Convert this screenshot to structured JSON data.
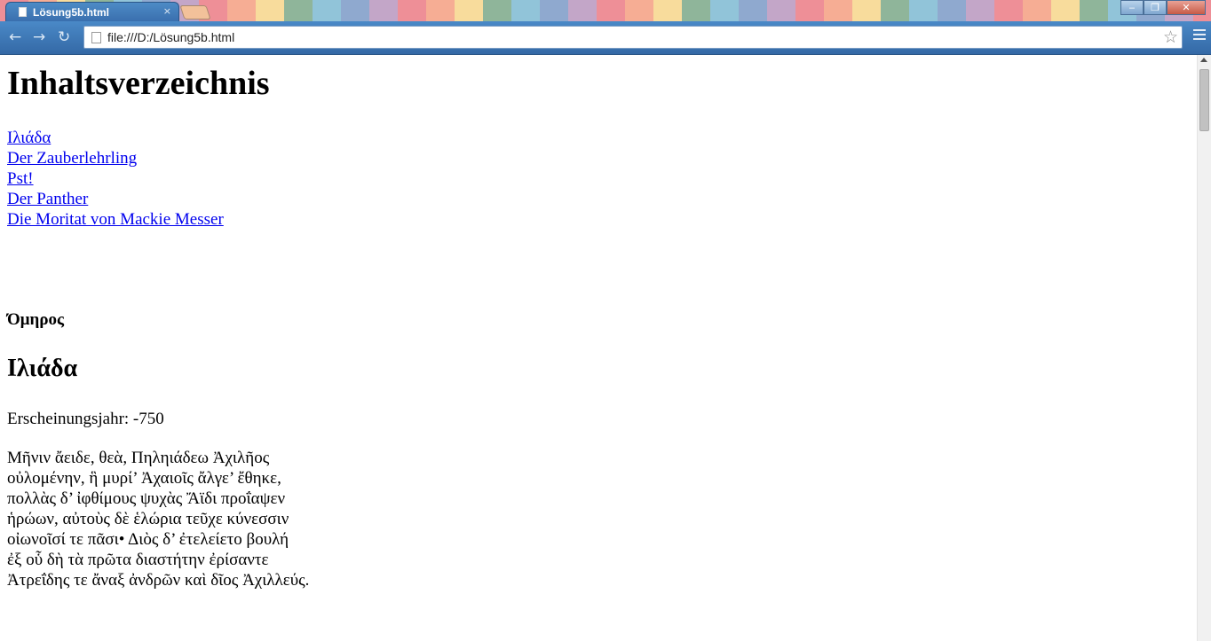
{
  "browser": {
    "tab_title": "Lösung5b.html",
    "tab_close": "×",
    "url": "file:///D:/Lösung5b.html",
    "window_controls": {
      "minimize": "‒",
      "restore": "❐",
      "close": "✕"
    },
    "nav": {
      "back": "←",
      "forward": "→",
      "reload": "↻"
    },
    "star": "☆"
  },
  "page": {
    "title": "Inhaltsverzeichnis",
    "toc": [
      "Ιλιάδα",
      "Der Zauberlehrling",
      "Pst! ",
      "Der Panther",
      "Die Moritat von Mackie Messer"
    ],
    "author": "Όμηρος",
    "work_title": "Ιλιάδα",
    "year_line": "Erscheinungsjahr: -750",
    "poem_lines": [
      "Μῆνιν ἄειδε, θεὰ, Πηληιάδεω Ἀχιλῆος",
      "οὐλομένην, ἣ μυρί’ Ἀχαιοῖς ἄλγε’ ἔθηκε,",
      "πολλὰς δ’ ἰφθίμους ψυχὰς Ἄϊδι προΐαψεν",
      "ἡρώων, αὐτοὺς δὲ ἑλώρια τεῦχε κύνεσσιν",
      "οἰωνοῖσί τε πᾶσι• Διὸς δ’ ἐτελείετο βουλή",
      "ἐξ οὗ δὴ τὰ πρῶτα διαστήτην ἐρίσαντε",
      "Ἀτρεΐδης τε ἄναξ ἀνδρῶν καὶ δῖος Ἀχιλλεύς."
    ]
  }
}
